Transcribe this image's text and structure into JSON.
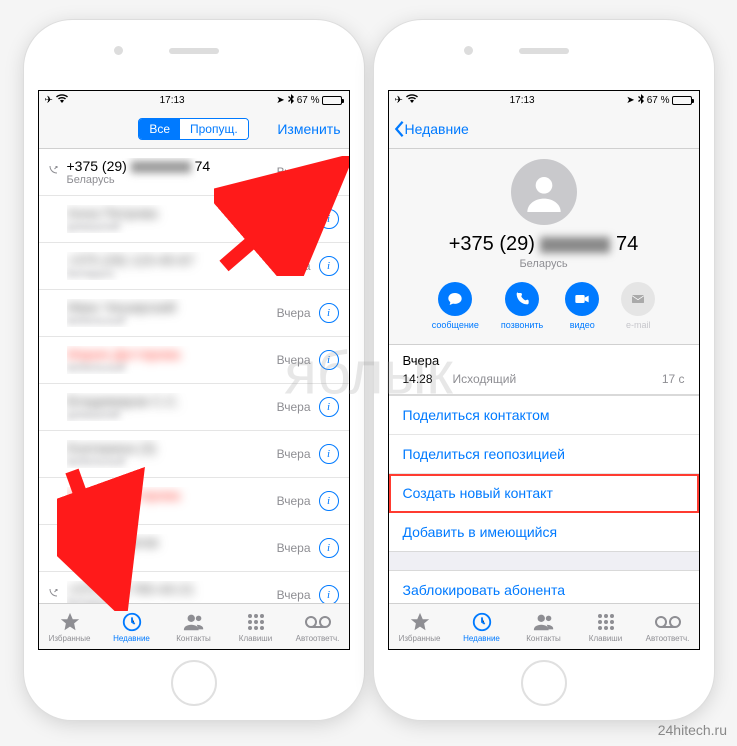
{
  "status": {
    "time": "17:13",
    "battery": "67 %"
  },
  "left": {
    "seg_all": "Все",
    "seg_missed": "Пропущ.",
    "edit": "Изменить",
    "rows": [
      {
        "title_prefix": "+375 (29)",
        "title_suffix": "74",
        "sub": "Беларусь",
        "time": "Вчера",
        "outgoing": true,
        "missed": false
      },
      {
        "title_prefix": "Анна Петрова",
        "title_suffix": "",
        "sub": "домашний",
        "time": "Вчера",
        "missed": false,
        "blur": true
      },
      {
        "title_prefix": "+375 (29) 123-45-67",
        "title_suffix": "",
        "sub": "Беларусь",
        "time": "Вчера",
        "missed": false,
        "blur": true
      },
      {
        "title_prefix": "Иван Чеширский",
        "title_suffix": "",
        "sub": "мобильный",
        "time": "Вчера",
        "missed": false,
        "blur": true
      },
      {
        "title_prefix": "Мария Дегтярева",
        "title_suffix": "",
        "sub": "мобильный",
        "time": "Вчера",
        "missed": true,
        "blur": true
      },
      {
        "title_prefix": "Владимиров С.С.",
        "title_suffix": "",
        "sub": "домашний",
        "time": "Вчера",
        "missed": false,
        "blur": true
      },
      {
        "title_prefix": "Екатерина (3)",
        "title_suffix": "",
        "sub": "мобильный",
        "time": "Вчера",
        "missed": false,
        "blur": true
      },
      {
        "title_prefix": "Мария Дегтярева",
        "title_suffix": "",
        "sub": "мобильный",
        "time": "Вчера",
        "missed": true,
        "blur": true
      },
      {
        "title_prefix": "Сергей Орлов",
        "title_suffix": "",
        "sub": "мобильный",
        "time": "Вчера",
        "missed": false,
        "blur": true
      },
      {
        "title_prefix": "+375 (29) 765-43-21",
        "title_suffix": "",
        "sub": "Беларусь",
        "time": "Вчера",
        "missed": false,
        "blur": true,
        "outgoing": true
      }
    ]
  },
  "tabs": {
    "fav": "Избранные",
    "recent": "Недавние",
    "contacts": "Контакты",
    "keypad": "Клавиши",
    "vm": "Автоответч."
  },
  "right": {
    "back": "Недавние",
    "number_prefix": "+375 (29)",
    "number_suffix": "74",
    "country": "Беларусь",
    "actions": {
      "msg": "сообщение",
      "call": "позвонить",
      "video": "видео",
      "mail": "e-mail"
    },
    "call_log": {
      "day": "Вчера",
      "time": "14:28",
      "type": "Исходящий",
      "duration": "17 с"
    },
    "items": {
      "share_contact": "Поделиться контактом",
      "share_location": "Поделиться геопозицией",
      "create_new": "Создать новый контакт",
      "add_existing": "Добавить в имеющийся",
      "block": "Заблокировать абонента"
    }
  },
  "watermark": "яблык",
  "watermark_br": "24hitech.ru"
}
